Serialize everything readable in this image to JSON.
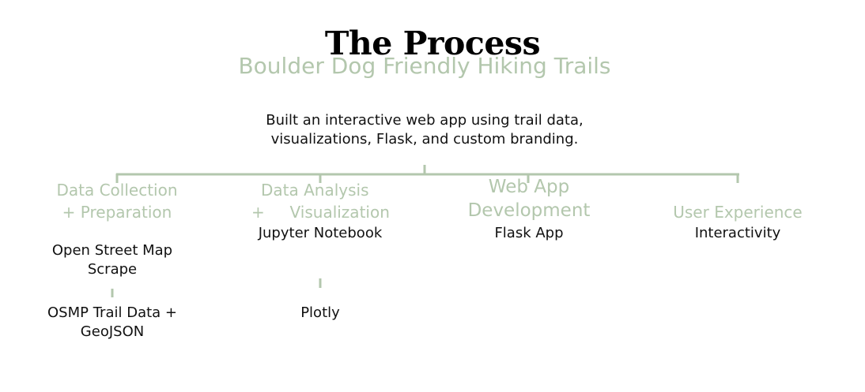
{
  "slide": {
    "title": "The Process",
    "subtitle": "Boulder Dog Friendly Hiking Trails",
    "description": "Built an interactive web app using trail data, visualizations, Flask, and custom branding."
  },
  "colors": {
    "accent": "#b3c7ad",
    "text": "#111111",
    "title": "#000000",
    "background": "#ffffff"
  },
  "stages": [
    {
      "heading_lines": [
        "Data Collection",
        "+ Preparation"
      ],
      "items": [
        "Open Street Map Scrape",
        "OSMP Trail Data + GeoJSON"
      ]
    },
    {
      "heading_lines": [
        "Data Analysis",
        "+     Visualization"
      ],
      "items": [
        "Jupyter Notebook",
        "Plotly"
      ]
    },
    {
      "heading_lines": [
        "Web App",
        "Development"
      ],
      "items": [
        "Flask App"
      ]
    },
    {
      "heading_lines": [
        "User Experience"
      ],
      "items": [
        "Interactivity"
      ]
    }
  ]
}
